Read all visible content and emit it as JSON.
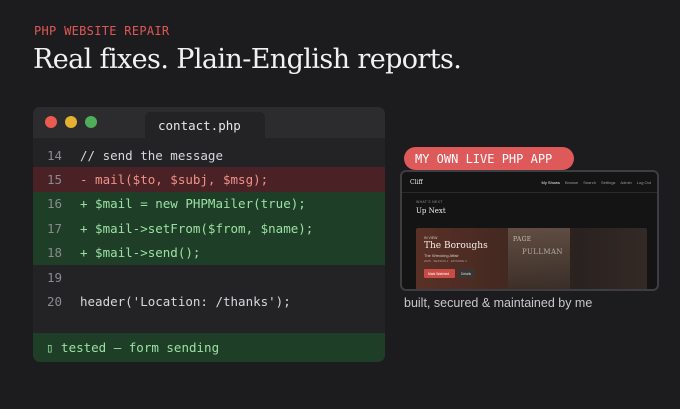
{
  "header": {
    "eyebrow": "PHP WEBSITE REPAIR",
    "headline": "Real fixes. Plain-English reports."
  },
  "editor": {
    "tab_label": "contact.php",
    "lines": [
      {
        "num": "14",
        "text": "// send the message",
        "type": "context"
      },
      {
        "num": "15",
        "text": "- mail($to, $subj, $msg);",
        "type": "removed"
      },
      {
        "num": "16",
        "text": "+ $mail = new PHPMailer(true);",
        "type": "added"
      },
      {
        "num": "17",
        "text": "+ $mail->setFrom($from, $name);",
        "type": "added"
      },
      {
        "num": "18",
        "text": "+ $mail->send();",
        "type": "added"
      },
      {
        "num": "19",
        "text": "",
        "type": "context"
      },
      {
        "num": "20",
        "text": "header('Location: /thanks');",
        "type": "context"
      }
    ],
    "status": "▯ tested — form sending"
  },
  "showcase": {
    "pill": "MY OWN LIVE PHP APP",
    "caption": "built, secured & maintained by me",
    "preview": {
      "logo": "Cliff",
      "nav": [
        "My Shows",
        "Browse",
        "Search",
        "Settings",
        "Admin",
        "Log Out"
      ],
      "section_small": "WHAT'S NEXT",
      "section_title": "Up Next",
      "hero_meta": "IN VIEW",
      "hero_title": "The Boroughs",
      "hero_subtitle": "The Wrecking Affair",
      "hero_subtitle2": "2025 · SEASON 1 · EPISODE 4",
      "hero_primary": "Mark Watched",
      "hero_secondary": "Details",
      "poster_line1": "PAGE",
      "poster_line2": "PULLMAN"
    }
  },
  "colors": {
    "background": "#1c1c1e",
    "accent": "#de5959",
    "diff_removed_bg": "#4a2226",
    "diff_added_bg": "#1f3e27",
    "diff_added_text": "#9be0a3"
  }
}
